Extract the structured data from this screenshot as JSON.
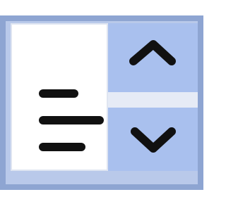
{
  "icon": {
    "name": "text-align-stepper-icon",
    "frame_color": "#8ea5d2",
    "fill_color": "#b9c9ea",
    "field_color": "#ffffff",
    "stepper_color": "#a9c0ee",
    "divider_color": "#e6ebf6",
    "glyph_color": "#111111"
  }
}
